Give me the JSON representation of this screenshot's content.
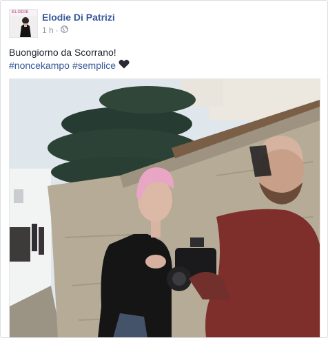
{
  "post": {
    "author": "Elodie Di Patrizi",
    "avatar_brand": "ELODIE",
    "time": "1 h",
    "separator": "·",
    "privacy_icon": "globe-icon",
    "text_line": "Buongiorno da Scorrano!",
    "hashtags": [
      "#noncekampo",
      "#semplice"
    ],
    "emoji_icon": "black-heart-icon"
  }
}
